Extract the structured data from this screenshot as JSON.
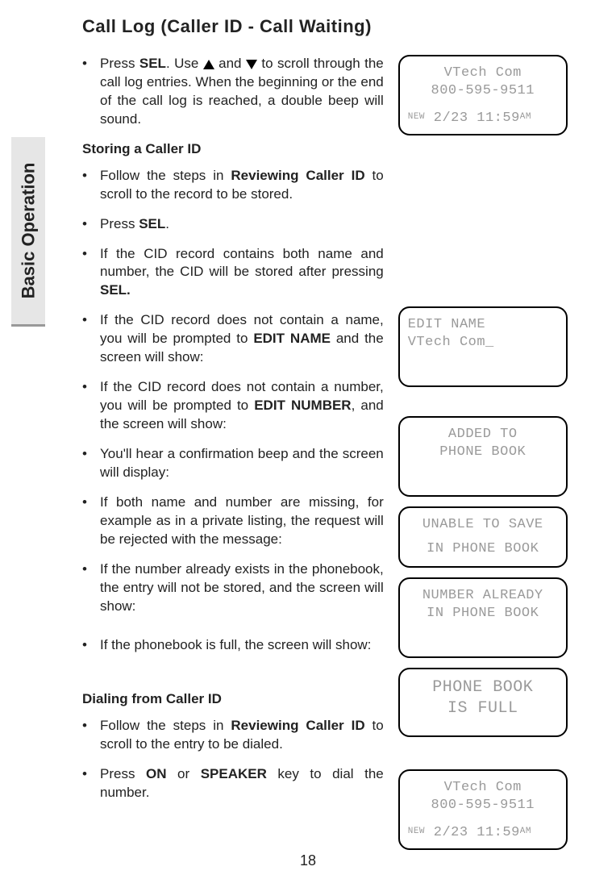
{
  "title": "Call Log (Caller ID - Call Waiting)",
  "side_tab": "Basic Operation",
  "page_number": "18",
  "bullets": {
    "b1a": "  Press ",
    "b1b": "SEL",
    "b1c": ". Use ",
    "b1d": " and ",
    "b1e": " to scroll through the call log entries. When the beginning or the end of the call log is reached, a double beep will sound."
  },
  "store_h": "Storing a Caller ID",
  "store": {
    "s1a": "  Follow the steps in ",
    "s1b": "Reviewing Caller ID",
    "s1c": " to scroll to the record to be stored.",
    "s2a": " Press ",
    "s2b": "SEL",
    "s2c": ".",
    "s3a": " If the CID record contains both name and number, the CID will be stored after pressing ",
    "s3b": "SEL.",
    "s4a": "  If the CID record does not contain a name, you will be prompted to ",
    "s4b": "EDIT NAME",
    "s4c": " and the screen will show:",
    "s5a": "  If the CID record does not contain a number, you will be prompted to ",
    "s5b": "EDIT NUMBER",
    "s5c": ", and the screen will show:",
    "s6": " You'll hear a confirmation beep and the screen will display:",
    "s7": " If both name and number are missing, for example as in a private listing, the request will be rejected with the message:",
    "s8": " If the number already exists in the phonebook, the entry will not be stored, and the screen will show:",
    "s9": " If the phonebook is full, the screen will show:"
  },
  "dial_h": "Dialing from Caller ID",
  "dial": {
    "d1a": " Follow the steps in ",
    "d1b": "Reviewing Caller ID",
    "d1c": " to scroll to the entry to be dialed.",
    "d2a": "  Press ",
    "d2b": "ON",
    "d2c": " or ",
    "d2d": "SPEAKER",
    "d2e": " key to dial the number."
  },
  "lcd1": {
    "l1": "VTech Com",
    "l2": "800-595-9511",
    "new": "NEW",
    "ts": " 2/23 11:59",
    "ampm": "AM"
  },
  "lcd_edit": {
    "l1": "EDIT NAME",
    "l2": "VTech Com_"
  },
  "lcd_added": {
    "l1": "ADDED TO",
    "l2": "PHONE BOOK"
  },
  "lcd_unable": {
    "l1": "UNABLE TO SAVE",
    "l2": "IN PHONE BOOK"
  },
  "lcd_exists": {
    "l1": "NUMBER ALREADY",
    "l2": "IN PHONE BOOK"
  },
  "lcd_full": {
    "l1": "PHONE BOOK",
    "l2": "IS FULL"
  },
  "lcd2": {
    "l1": "VTech Com",
    "l2": "800-595-9511",
    "new": "NEW",
    "ts": " 2/23 11:59",
    "ampm": "AM"
  }
}
